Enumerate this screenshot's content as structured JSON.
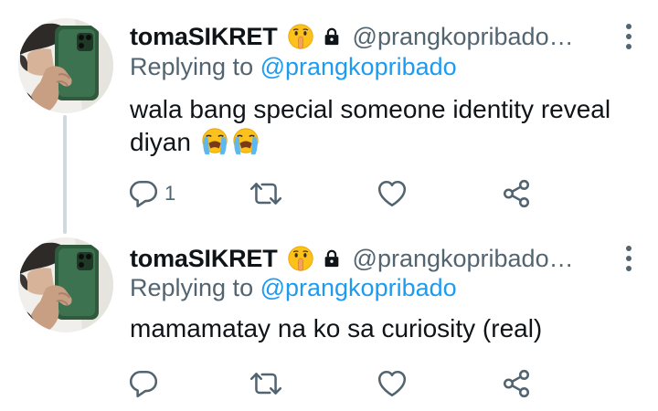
{
  "tweets": [
    {
      "display_name": "tomaSIKRET",
      "handle": "@prangkopribado…",
      "replying_prefix": "Replying to ",
      "replying_mention": "@prangkopribado",
      "text": "wala bang special someone identity reveal diyan",
      "reply_count": "1"
    },
    {
      "display_name": "tomaSIKRET",
      "handle": "@prangkopribado…",
      "replying_prefix": "Replying to ",
      "replying_mention": "@prangkopribado",
      "text": "mamamatay na ko sa curiosity (real)",
      "reply_count": ""
    }
  ],
  "colors": {
    "text_primary": "#0f1419",
    "text_secondary": "#536471",
    "mention": "#1d9bf0",
    "thread_line": "#cfd9de"
  },
  "icons": {
    "name_emoji": "shushing-face-emoji",
    "protected": "lock-icon",
    "reaction_emoji": "loudly-crying-face-emoji",
    "reply": "reply-icon",
    "retweet": "retweet-icon",
    "like": "heart-icon",
    "share": "share-icon",
    "more": "more-options-icon"
  }
}
